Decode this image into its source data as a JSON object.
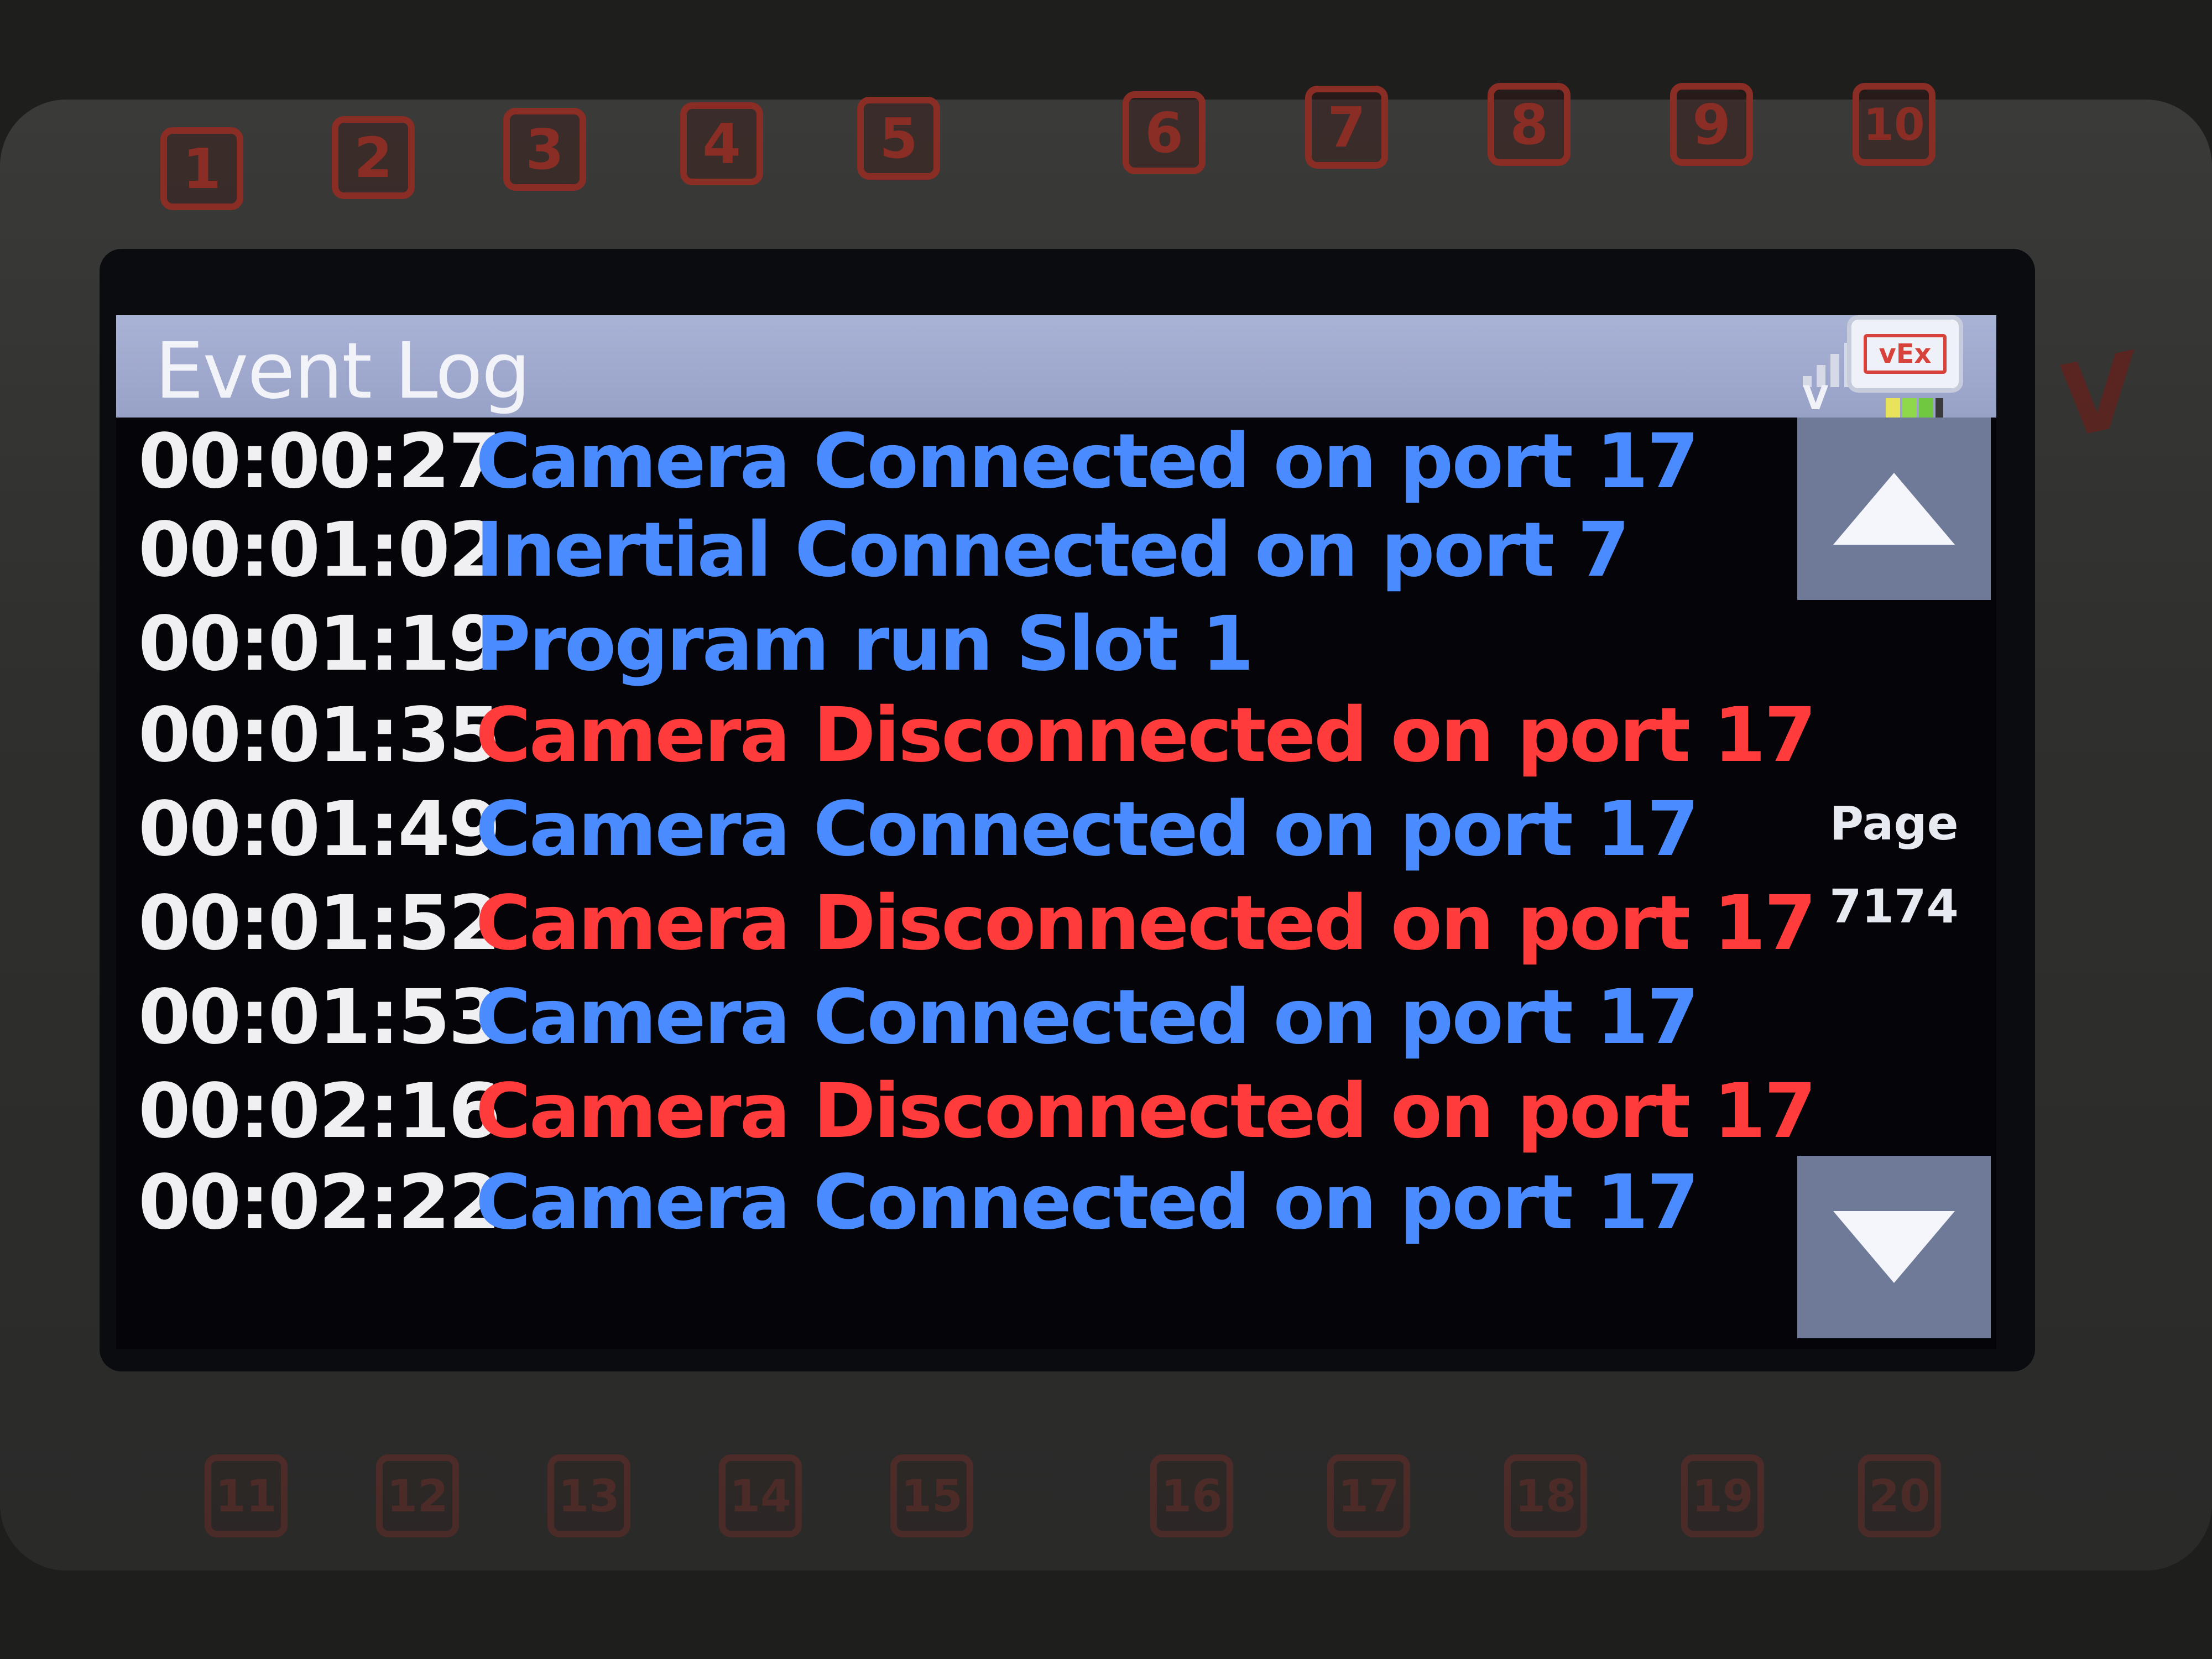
{
  "device": {
    "top_ports": [
      "1",
      "2",
      "3",
      "4",
      "5",
      "6",
      "7",
      "8",
      "9",
      "10"
    ],
    "bottom_ports": [
      "11",
      "12",
      "13",
      "14",
      "15",
      "16",
      "17",
      "18",
      "19",
      "20"
    ]
  },
  "header": {
    "title": "Event Log",
    "signal_icon": "signal-icon",
    "signal_letter": "V",
    "brain_icon": "vex-brain-icon",
    "brain_icon_text": "vEx",
    "battery_icon": "battery-icon"
  },
  "log": {
    "entries": [
      {
        "time": "00:00:27",
        "message": "Camera Connected on port 17",
        "type": "connect"
      },
      {
        "time": "00:01:02",
        "message": "Inertial Connected on port 7",
        "type": "connect"
      },
      {
        "time": "00:01:19",
        "message": "Program run Slot 1",
        "type": "connect"
      },
      {
        "time": "00:01:35",
        "message": "Camera Disconnected on port 17",
        "type": "disconnect"
      },
      {
        "time": "00:01:49",
        "message": "Camera Connected on port 17",
        "type": "connect"
      },
      {
        "time": "00:01:52",
        "message": "Camera Disconnected on port 17",
        "type": "disconnect"
      },
      {
        "time": "00:01:53",
        "message": "Camera Connected on port 17",
        "type": "connect"
      },
      {
        "time": "00:02:16",
        "message": "Camera Disconnected on port 17",
        "type": "disconnect"
      },
      {
        "time": "00:02:22",
        "message": "Camera Connected on port 17",
        "type": "connect"
      }
    ]
  },
  "pager": {
    "label": "Page",
    "value": "7174",
    "up_icon": "arrow-up-icon",
    "down_icon": "arrow-down-icon"
  },
  "colors": {
    "connect": "#4a8bff",
    "disconnect": "#ff3b3b",
    "titlebar": "#a9b3d6",
    "port_outline": "#8a2d25"
  }
}
